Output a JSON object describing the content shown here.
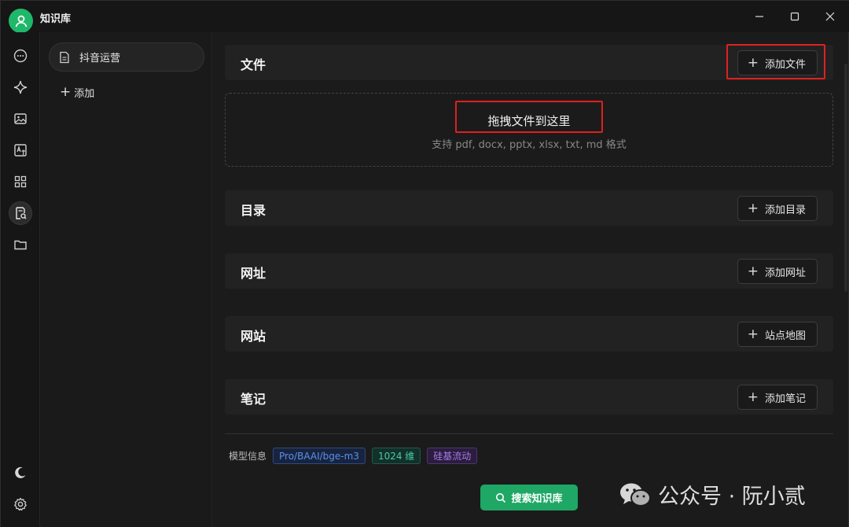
{
  "app": {
    "title": "知识库"
  },
  "kb_list": {
    "items": [
      {
        "label": "抖音运营"
      }
    ],
    "add_label": "添加"
  },
  "sections": [
    {
      "title": "文件",
      "button": "添加文件"
    },
    {
      "title": "目录",
      "button": "添加目录"
    },
    {
      "title": "网址",
      "button": "添加网址"
    },
    {
      "title": "网站",
      "button": "站点地图"
    },
    {
      "title": "笔记",
      "button": "添加笔记"
    }
  ],
  "dropzone": {
    "title": "拖拽文件到这里",
    "subtitle": "支持 pdf, docx, pptx, xlsx, txt, md 格式"
  },
  "model_info": {
    "label": "模型信息",
    "tags": [
      "Pro/BAAI/bge-m3",
      "1024 维",
      "硅基流动"
    ]
  },
  "search_button": "搜索知识库",
  "watermark": "公众号 · 阮小贰",
  "colors": {
    "accent": "#1fa765",
    "highlight": "#e02020",
    "tag_blue": "#5b8ff0",
    "tag_teal": "#4cc9a8",
    "tag_purple": "#a77ae8"
  },
  "rail_icons": [
    "chat-icon",
    "sparkle-icon",
    "image-icon",
    "translate-icon",
    "apps-icon",
    "knowledge-icon",
    "folder-icon",
    "moon-icon",
    "gear-icon"
  ]
}
